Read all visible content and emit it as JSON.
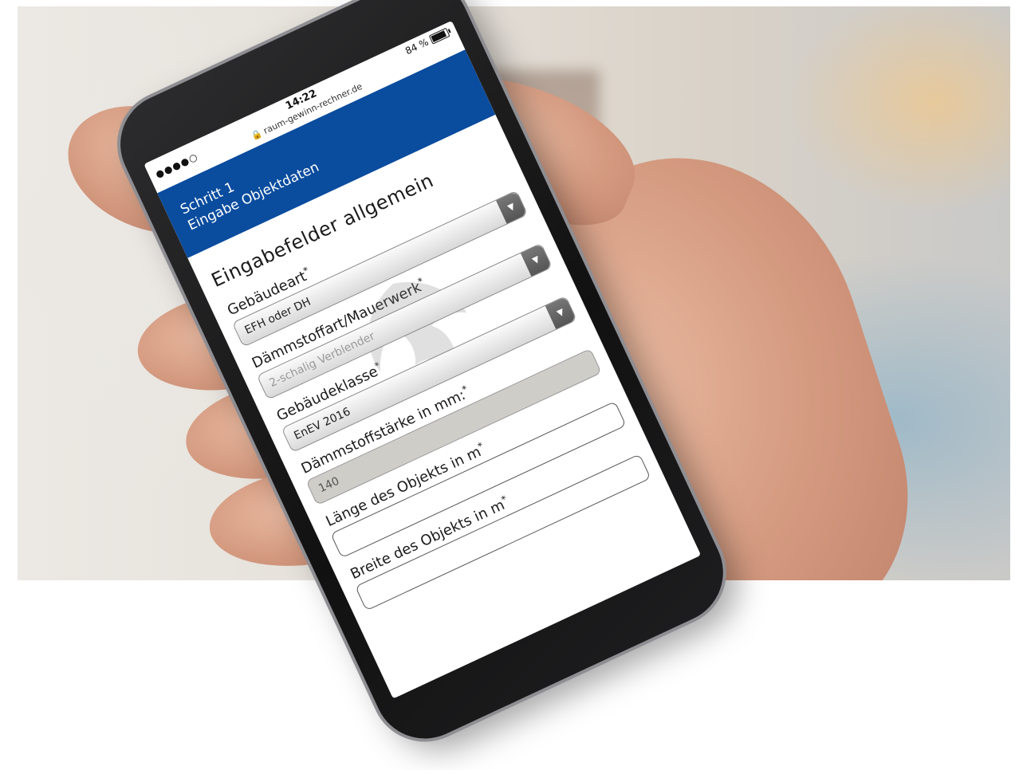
{
  "status_bar": {
    "signal": "●●●●○",
    "time": "14:22",
    "url": "raum-gewinn-rechner.de",
    "battery": "84 %"
  },
  "header": {
    "step": "Schritt 1",
    "subtitle": "Eingabe Objektdaten"
  },
  "form": {
    "title": "Eingabefelder allgemein",
    "fields": [
      {
        "label": "Gebäudeart",
        "required": "*",
        "value": "EFH oder DH"
      },
      {
        "label": "Dämmstoffart/Mauerwerk",
        "required": "*",
        "value": "2-schalig Verblender"
      },
      {
        "label": "Gebäudeklasse",
        "required": "*",
        "value": "EnEV 2016"
      },
      {
        "label": "Dämmstoffstärke in mm:",
        "required": "*",
        "value": "140"
      },
      {
        "label": "Länge des Objekts in m",
        "required": "*",
        "value": ""
      },
      {
        "label": "Breite des Objekts in m",
        "required": "*",
        "value": ""
      }
    ]
  },
  "colors": {
    "header_blue": "#0a4c9e",
    "disabled_input": "#cfcdc8"
  }
}
